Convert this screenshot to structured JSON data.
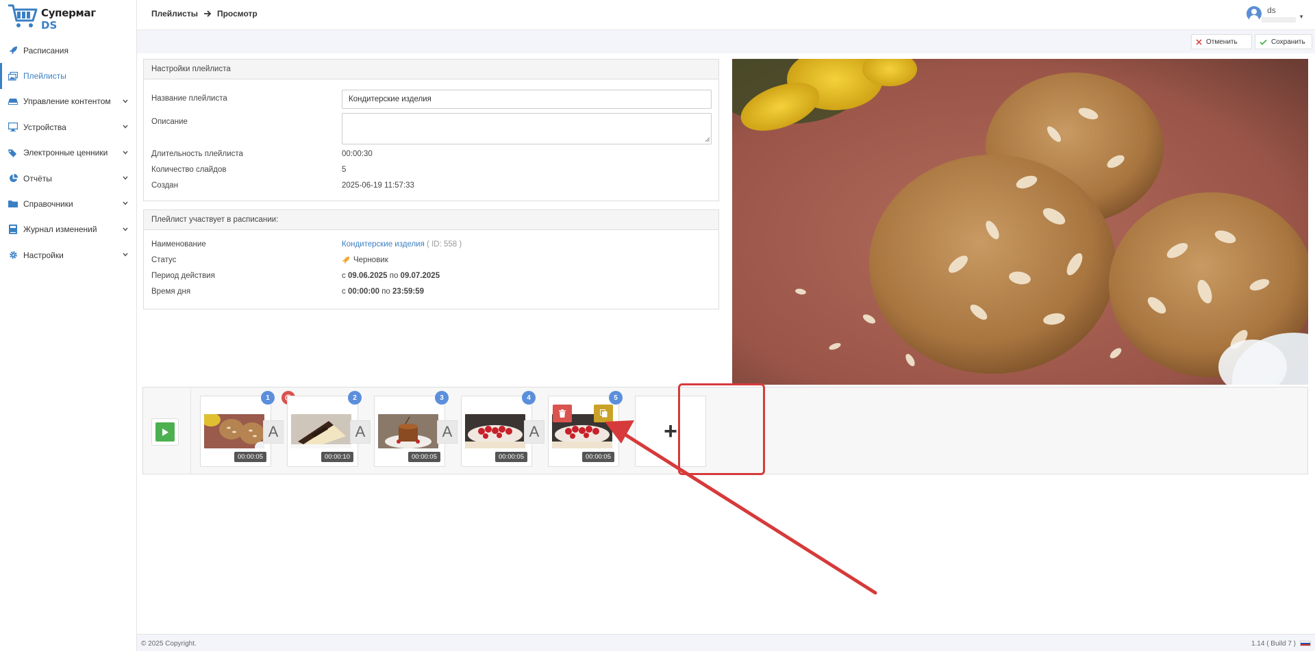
{
  "brand": {
    "line1": "Супермаг",
    "line2": "DS"
  },
  "sidebar": {
    "items": [
      {
        "label": "Расписания",
        "icon": "rocket-icon",
        "active": false,
        "expandable": false
      },
      {
        "label": "Плейлисты",
        "icon": "images-icon",
        "active": true,
        "expandable": false
      },
      {
        "label": "Управление контентом",
        "icon": "drive-icon",
        "active": false,
        "expandable": true
      },
      {
        "label": "Устройства",
        "icon": "monitor-icon",
        "active": false,
        "expandable": true
      },
      {
        "label": "Электронные ценники",
        "icon": "tags-icon",
        "active": false,
        "expandable": true
      },
      {
        "label": "Отчёты",
        "icon": "pie-chart-icon",
        "active": false,
        "expandable": true
      },
      {
        "label": "Справочники",
        "icon": "folder-icon",
        "active": false,
        "expandable": true
      },
      {
        "label": "Журнал изменений",
        "icon": "book-icon",
        "active": false,
        "expandable": true
      },
      {
        "label": "Настройки",
        "icon": "gear-icon",
        "active": false,
        "expandable": true
      }
    ]
  },
  "header": {
    "breadcrumb": [
      "Плейлисты",
      "Просмотр"
    ],
    "user": {
      "name": "ds"
    }
  },
  "actions": {
    "cancel": "Отменить",
    "save": "Сохранить"
  },
  "settings": {
    "title": "Настройки плейлиста",
    "name_label": "Название плейлиста",
    "name_value": "Кондитерские изделия",
    "desc_label": "Описание",
    "desc_value": "",
    "duration_label": "Длительность плейлиста",
    "duration_value": "00:00:30",
    "slides_label": "Количество слайдов",
    "slides_value": "5",
    "created_label": "Создан",
    "created_value": "2025-06-19 11:57:33"
  },
  "schedule": {
    "title": "Плейлист участвует в расписании:",
    "name_label": "Наименование",
    "name_value": "Кондитерские изделия",
    "id_value": "( ID: 558 )",
    "status_label": "Статус",
    "status_value": "Черновик",
    "period_label": "Период действия",
    "period_from_prefix": "с",
    "period_from": "09.06.2025",
    "period_mid": "по",
    "period_to": "09.07.2025",
    "time_label": "Время дня",
    "time_from_prefix": "с",
    "time_from": "00:00:00",
    "time_mid": "по",
    "time_to": "23:59:59"
  },
  "timeline": {
    "slides": [
      {
        "number": "1",
        "duration": "00:00:05",
        "warning": true
      },
      {
        "number": "2",
        "duration": "00:00:10",
        "warning": false
      },
      {
        "number": "3",
        "duration": "00:00:05",
        "warning": false
      },
      {
        "number": "4",
        "duration": "00:00:05",
        "warning": false
      },
      {
        "number": "5",
        "duration": "00:00:05",
        "warning": false
      }
    ],
    "transition_label": "A",
    "add_label": "+"
  },
  "footer": {
    "copyright": "© 2025 Copyright.",
    "version": "1.14 ( Build 7 )"
  },
  "colors": {
    "accent": "#3a7fc4",
    "danger": "#d9534f",
    "success": "#4caf50",
    "warning": "#c9a227",
    "badge": "#5b8fdc"
  }
}
